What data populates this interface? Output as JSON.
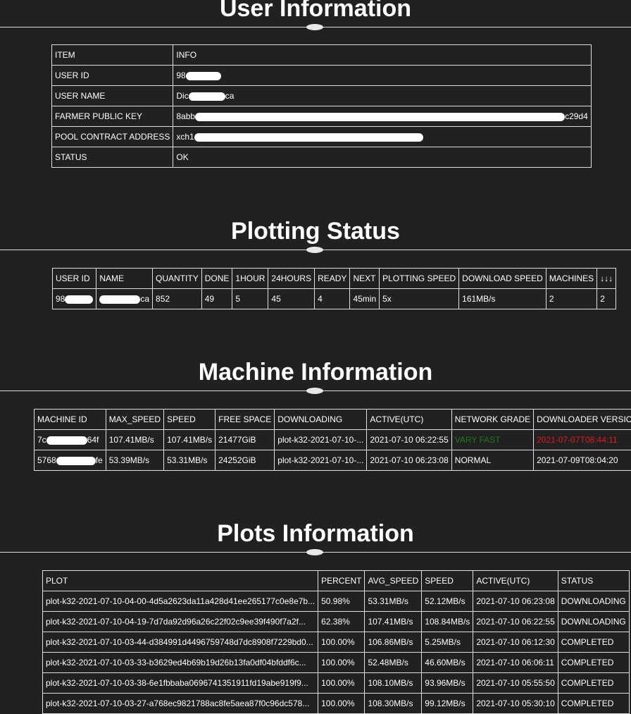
{
  "user_info": {
    "title": "User Information",
    "headers": [
      "ITEM",
      "INFO"
    ],
    "rows": [
      {
        "item": "USER ID",
        "pre": "98",
        "post": ""
      },
      {
        "item": "USER NAME",
        "pre": "Dic",
        "post": "ca"
      },
      {
        "item": "FARMER PUBLIC KEY",
        "pre": "8abb",
        "post": "c29d4"
      },
      {
        "item": "POOL CONTRACT ADDRESS",
        "pre": "xch1",
        "post": ""
      },
      {
        "item": "STATUS",
        "pre": "OK",
        "post": ""
      }
    ]
  },
  "plotting": {
    "title": "Plotting Status",
    "headers": [
      "USER ID",
      "NAME",
      "QUANTITY",
      "DONE",
      "1HOUR",
      "24HOURS",
      "READY",
      "NEXT",
      "PLOTTING SPEED",
      "DOWNLOAD SPEED",
      "MACHINES",
      "↓↓↓"
    ],
    "row": {
      "user_id_pre": "98",
      "name_post": "ca",
      "quantity": "852",
      "done": "49",
      "hour1": "5",
      "hours24": "45",
      "ready": "4",
      "next": "45min",
      "plotting_speed": "5x",
      "download_speed": "161MB/s",
      "machines": "2",
      "extra": "2"
    }
  },
  "machines": {
    "title": "Machine Information",
    "headers": [
      "MACHINE ID",
      "MAX_SPEED",
      "SPEED",
      "FREE SPACE",
      "DOWNLOADING",
      "ACTIVE(UTC)",
      "NETWORK GRADE",
      "DOWNLOADER VERSION"
    ],
    "rows": [
      {
        "id_pre": "7c",
        "id_post": "64f",
        "max_speed": "107.41MB/s",
        "speed": "107.41MB/s",
        "free": "21477GiB",
        "downloading": "plot-k32-2021-07-10-...",
        "active": "2021-07-10 06:22:55",
        "grade": "VARY FAST",
        "version": "2021-07-07T08:44:11"
      },
      {
        "id_pre": "5768",
        "id_post": "fe",
        "max_speed": "53.39MB/s",
        "speed": "53.31MB/s",
        "free": "24252GiB",
        "downloading": "plot-k32-2021-07-10-...",
        "active": "2021-07-10 06:23:08",
        "grade": "NORMAL",
        "version": "2021-07-09T08:04:20"
      }
    ],
    "colors": {
      "grade_fast": "#1f7a1f",
      "version_outdated": "#e01b1b"
    }
  },
  "plots": {
    "title": "Plots Information",
    "headers": [
      "PLOT",
      "PERCENT",
      "AVG_SPEED",
      "SPEED",
      "ACTIVE(UTC)",
      "STATUS"
    ],
    "rows": [
      [
        "plot-k32-2021-07-10-04-00-4d5a2623da11a428d41ee265177c0e8e7b...",
        "50.98%",
        "53.31MB/s",
        "52.12MB/s",
        "2021-07-10 06:23:08",
        "DOWNLOADING"
      ],
      [
        "plot-k32-2021-07-10-04-19-7d7da92d96a26c22f02c9ee39f490f7a2f...",
        "62.38%",
        "107.41MB/s",
        "108.84MB/s",
        "2021-07-10 06:22:55",
        "DOWNLOADING"
      ],
      [
        "plot-k32-2021-07-10-03-44-d384991d4496759748d7dc8908f7229bd0...",
        "100.00%",
        "106.86MB/s",
        "5.25MB/s",
        "2021-07-10 06:12:30",
        "COMPLETED"
      ],
      [
        "plot-k32-2021-07-10-03-33-b3629ed4b69b19d26b13fa0df04bfddf6c...",
        "100.00%",
        "52.48MB/s",
        "46.60MB/s",
        "2021-07-10 06:06:11",
        "COMPLETED"
      ],
      [
        "plot-k32-2021-07-10-03-38-6e1fbbaba0696741351911fd19abe919f9...",
        "100.00%",
        "108.10MB/s",
        "93.96MB/s",
        "2021-07-10 05:55:50",
        "COMPLETED"
      ],
      [
        "plot-k32-2021-07-10-03-27-a768ec9821788ac8fe5aea87f0c96dc578...",
        "100.00%",
        "108.30MB/s",
        "99.12MB/s",
        "2021-07-10 05:30:10",
        "COMPLETED"
      ]
    ]
  }
}
